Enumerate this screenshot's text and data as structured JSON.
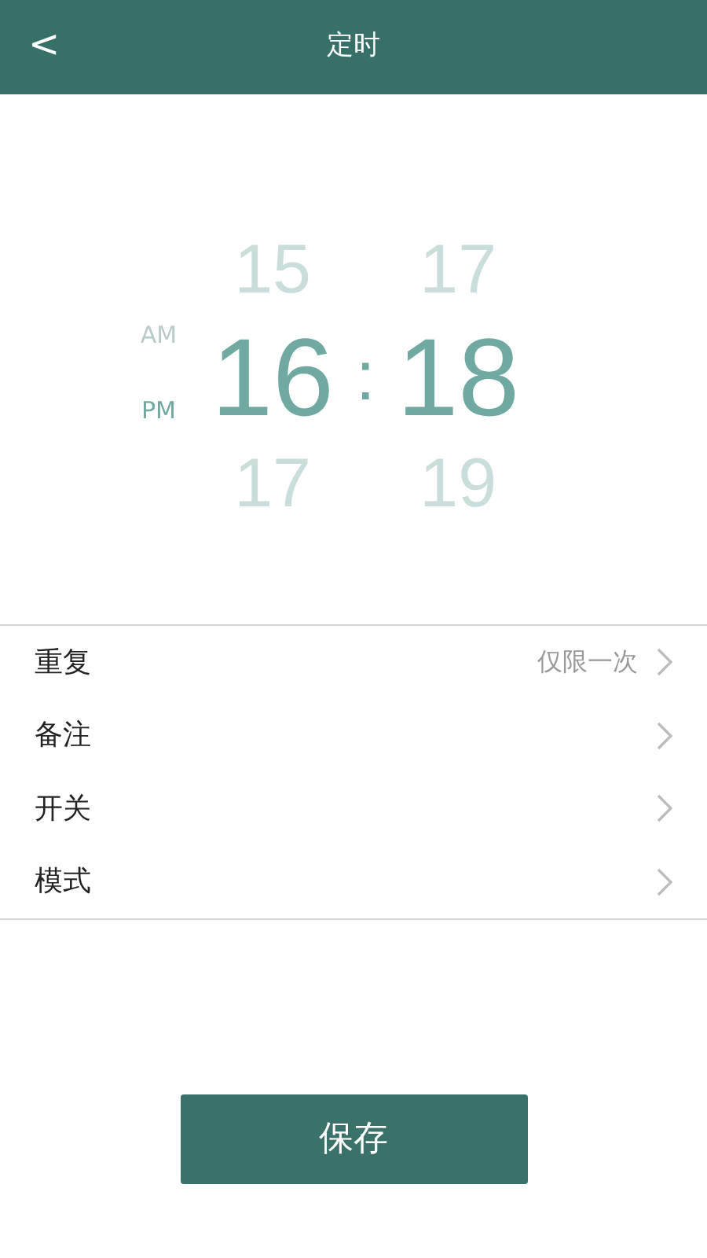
{
  "header": {
    "back": "<",
    "title": "定时"
  },
  "picker": {
    "meridiem": [
      {
        "label": "AM",
        "selected": false
      },
      {
        "label": "PM",
        "selected": true
      }
    ],
    "hours": [
      {
        "label": "15",
        "selected": false
      },
      {
        "label": "16",
        "selected": true
      },
      {
        "label": "17",
        "selected": false
      }
    ],
    "separator": ":",
    "minutes": [
      {
        "label": "17",
        "selected": false
      },
      {
        "label": "18",
        "selected": true
      },
      {
        "label": "19",
        "selected": false
      }
    ]
  },
  "settings": [
    {
      "label": "重复",
      "value": "仅限一次"
    },
    {
      "label": "备注"
    },
    {
      "label": "开关"
    },
    {
      "label": "模式"
    }
  ],
  "save_button": "保存"
}
